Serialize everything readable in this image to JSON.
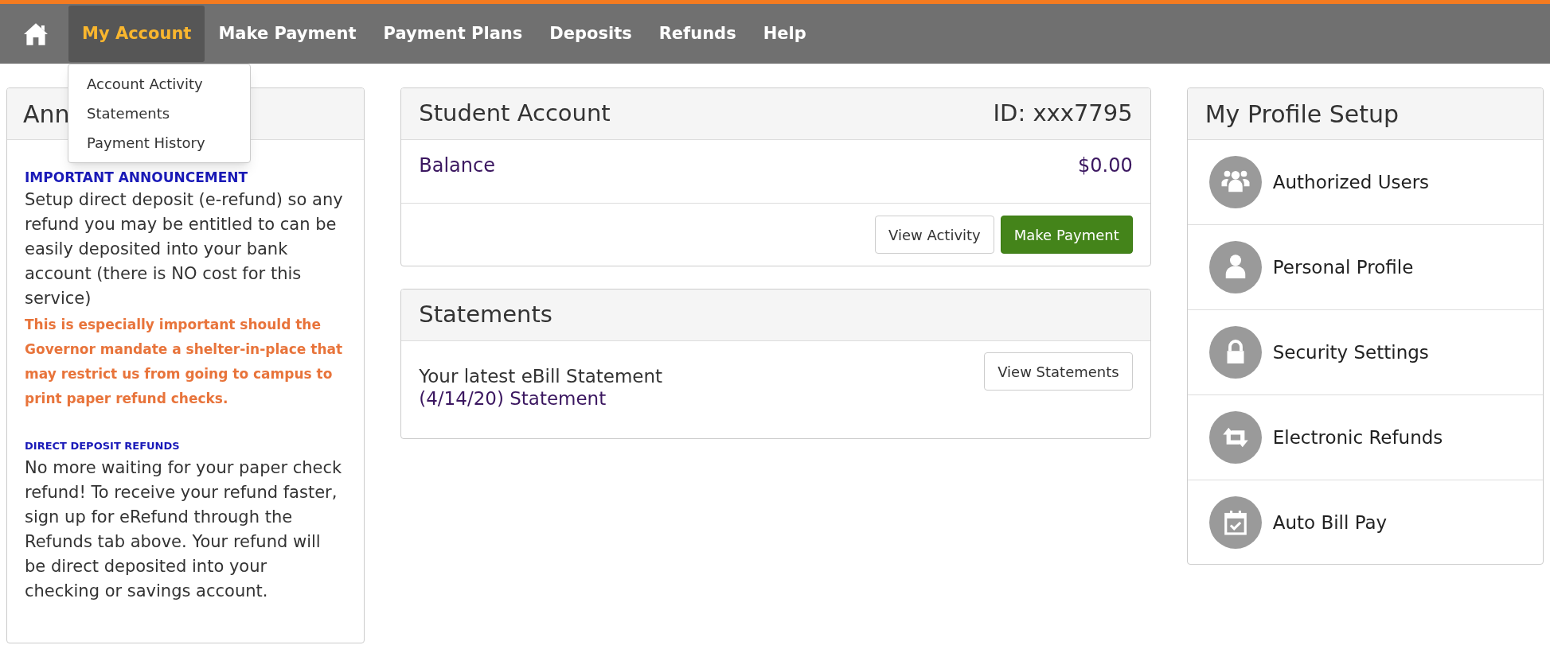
{
  "nav": {
    "items": [
      {
        "label": "My Account",
        "selected": true
      },
      {
        "label": "Make Payment",
        "selected": false
      },
      {
        "label": "Payment Plans",
        "selected": false
      },
      {
        "label": "Deposits",
        "selected": false
      },
      {
        "label": "Refunds",
        "selected": false
      },
      {
        "label": "Help",
        "selected": false
      }
    ],
    "dropdown": {
      "items": [
        "Account Activity",
        "Statements",
        "Payment History"
      ]
    }
  },
  "announcements": {
    "title": "Ann",
    "blocks": [
      {
        "kind": "heading",
        "text": "IMPORTANT ANNOUNCEMENT"
      },
      {
        "kind": "paragraph",
        "text": "Setup direct deposit (e-refund) so any refund you may be entitled to can be easily deposited into your bank account (there is NO cost for this service)"
      },
      {
        "kind": "alert",
        "text": "This is especially important should the Governor mandate a shelter-in-place that may restrict us from going to campus to print paper refund checks."
      },
      {
        "kind": "subheading",
        "text": "DIRECT DEPOSIT REFUNDS"
      },
      {
        "kind": "paragraph",
        "text": "No more waiting for your paper check refund! To receive your refund faster, sign up for eRefund through the Refunds tab above. Your refund will be direct deposited into your checking or savings account."
      }
    ]
  },
  "student_account": {
    "title": "Student Account",
    "id": "ID: xxx7795",
    "balance_label": "Balance",
    "balance_value": "$0.00",
    "buttons": [
      {
        "label": "View Activity",
        "kind": "secondary"
      },
      {
        "label": "Make Payment",
        "kind": "primary"
      }
    ]
  },
  "statements": {
    "title": "Statements",
    "latest_label": "Your latest eBill Statement",
    "statement_link": "(4/14/20) Statement",
    "button": "View Statements"
  },
  "profile": {
    "title": "My Profile Setup",
    "items": [
      {
        "label": "Authorized Users",
        "kind": "users"
      },
      {
        "label": "Personal Profile",
        "kind": "user"
      },
      {
        "label": "Security Settings",
        "kind": "lock"
      },
      {
        "label": "Electronic Refunds",
        "kind": "exchange"
      },
      {
        "label": "Auto Bill Pay",
        "kind": "calendar"
      }
    ]
  }
}
